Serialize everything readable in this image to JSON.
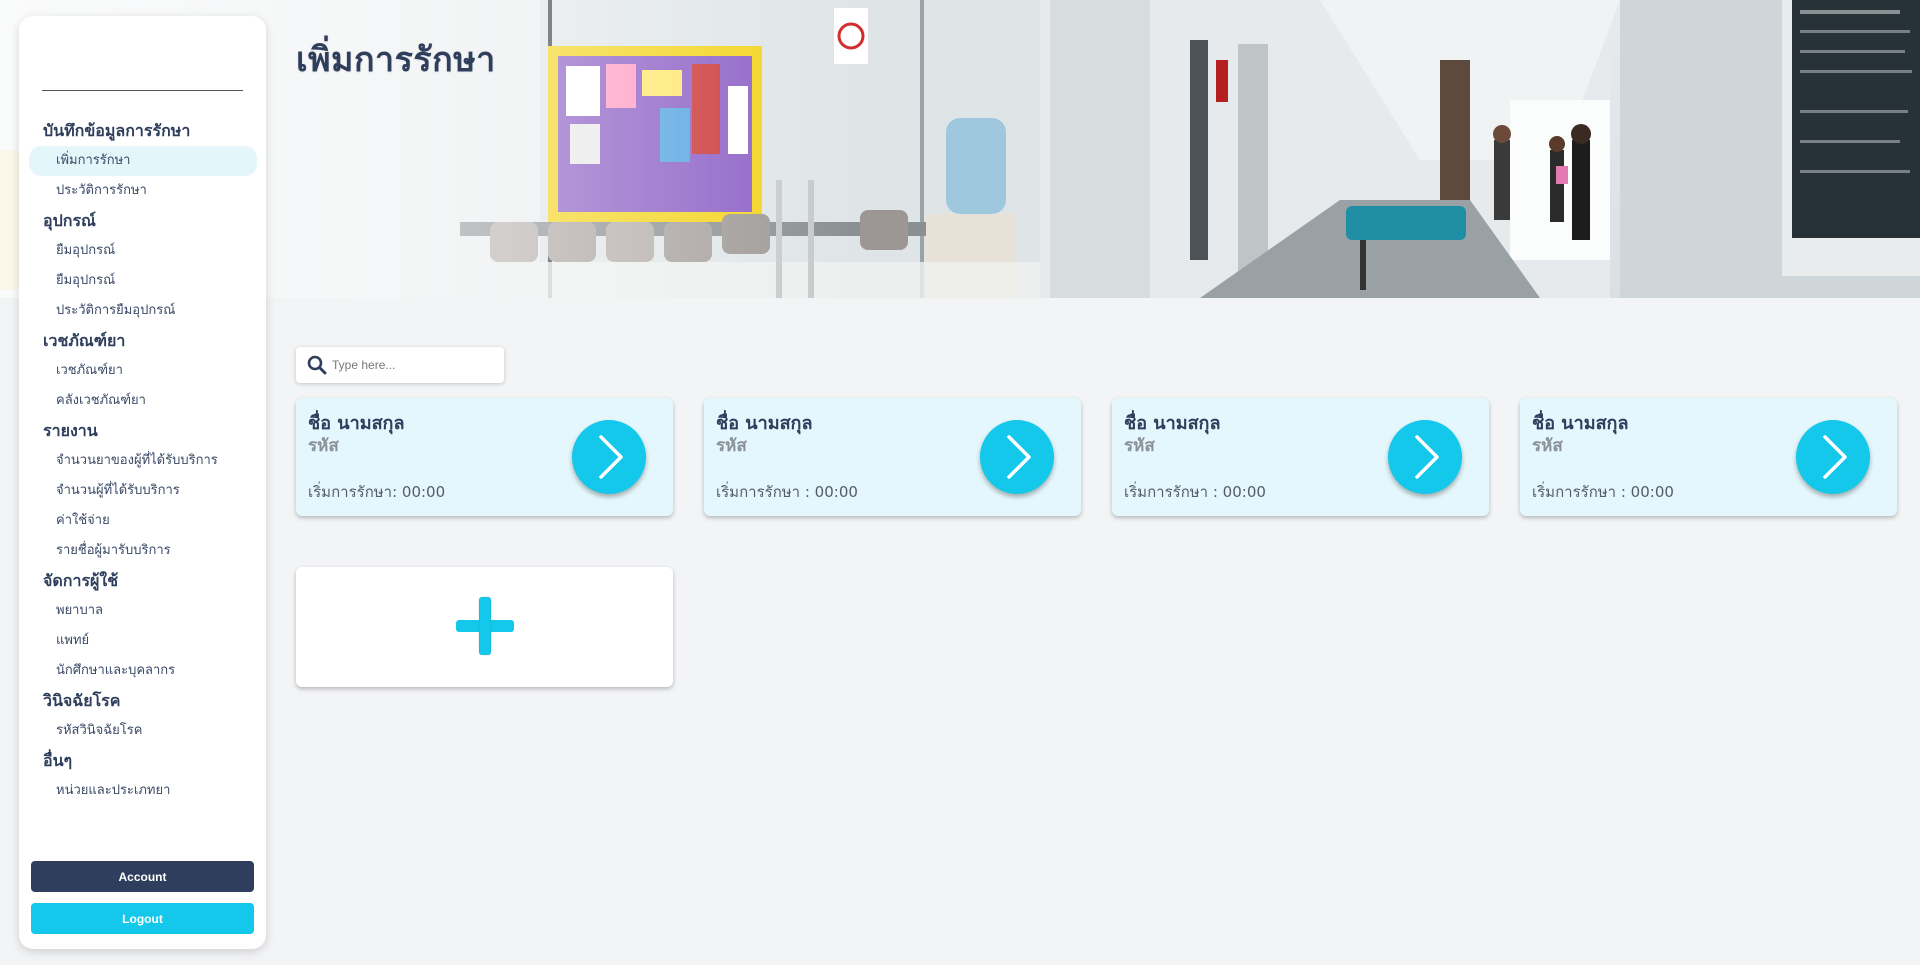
{
  "header": {
    "title": "เพิ่มการรักษา"
  },
  "sidebar": {
    "sections": [
      {
        "title": "บันทึกข้อมูลการรักษา",
        "items": [
          "เพิ่มการรักษา",
          "ประวัติการรักษา"
        ]
      },
      {
        "title": "อุปกรณ์",
        "items": [
          "ยืมอุปกรณ์",
          "ยืมอุปกรณ์",
          "ประวัติการยืมอุปกรณ์"
        ]
      },
      {
        "title": "เวชภัณฑ์ยา",
        "items": [
          "เวชภัณฑ์ยา",
          "คลังเวชภัณฑ์ยา"
        ]
      },
      {
        "title": "รายงาน",
        "items": [
          "จำนวนยาของผู้ที่ได้รับบริการ",
          "จำนวนผู้ที่ได้รับบริการ",
          "ค่าใช้จ่าย",
          "รายชื่อผู้มารับบริการ"
        ]
      },
      {
        "title": "จัดการผู้ใช้",
        "items": [
          "พยาบาล",
          "แพทย์",
          "นักศึกษาและบุคลากร"
        ]
      },
      {
        "title": "วินิจฉัยโรค",
        "items": [
          "รหัสวินิจฉัยโรค"
        ]
      },
      {
        "title": "อื่นๆ",
        "items": [
          "หน่วยและประเภทยา"
        ]
      }
    ],
    "active_item": "เพิ่มการรักษา",
    "account_label": "Account",
    "logout_label": "Logout"
  },
  "search": {
    "placeholder": "Type here...",
    "value": ""
  },
  "cards": [
    {
      "name": "ชื่อ นามสกุล",
      "code": "รหัส",
      "start_time": "เริ่มการรักษา: 00:00"
    },
    {
      "name": "ชื่อ นามสกุล",
      "code": "รหัส",
      "start_time": "เริ่มการรักษา : 00:00"
    },
    {
      "name": "ชื่อ นามสกุล",
      "code": "รหัส",
      "start_time": "เริ่มการรักษา : 00:00"
    },
    {
      "name": "ชื่อ นามสกุล",
      "code": "รหัส",
      "start_time": "เริ่มการรักษา : 00:00"
    }
  ],
  "icons": {
    "search": "search-icon",
    "card_go": "chevron-right-icon",
    "add": "plus-icon"
  },
  "colors": {
    "primary_navy": "#2e3e5c",
    "accent_cyan": "#13c8ea",
    "card_bg": "#e4f7fc",
    "active_item_bg": "#e5f6fb",
    "page_bg": "#f3f4f6"
  }
}
